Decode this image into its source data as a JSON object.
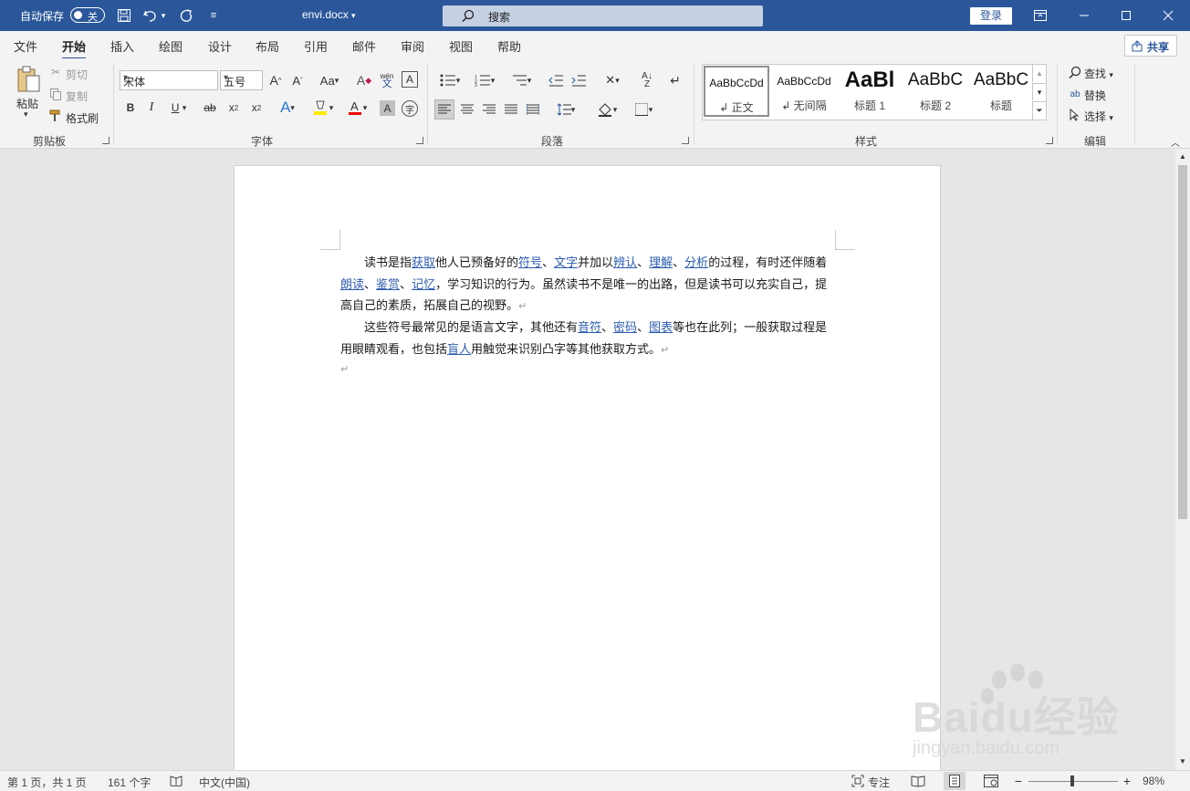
{
  "titlebar": {
    "autosave_label": "自动保存",
    "autosave_state": "关",
    "filename": "envi.docx",
    "search_placeholder": "搜索",
    "login_label": "登录",
    "colors": {
      "bar": "#2b579a"
    }
  },
  "tabs": [
    "文件",
    "开始",
    "插入",
    "绘图",
    "设计",
    "布局",
    "引用",
    "邮件",
    "审阅",
    "视图",
    "帮助"
  ],
  "active_tab": "开始",
  "share_label": "共享",
  "clipboard": {
    "paste": "粘贴",
    "cut": "剪切",
    "copy": "复制",
    "format_painter": "格式刷",
    "group": "剪贴板"
  },
  "font": {
    "name": "宋体",
    "size": "五号",
    "group": "字体",
    "phonetic_top": "wén",
    "phonetic_bottom": "文",
    "aa": "Aa"
  },
  "paragraph": {
    "group": "段落"
  },
  "styles": {
    "items": [
      {
        "preview": "AaBbCcDd",
        "name": "↲ 正文"
      },
      {
        "preview": "AaBbCcDd",
        "name": "↲ 无间隔"
      },
      {
        "preview": "AaBl",
        "name": "标题 1"
      },
      {
        "preview": "AaBbC",
        "name": "标题 2"
      },
      {
        "preview": "AaBbC",
        "name": "标题"
      }
    ],
    "group": "样式"
  },
  "editing": {
    "find": "查找",
    "replace": "替换",
    "select": "选择",
    "group": "编辑"
  },
  "document": {
    "p1": [
      {
        "t": "读书是指",
        "link": false
      },
      {
        "t": "获取",
        "link": true
      },
      {
        "t": "他人已预备好的",
        "link": false
      },
      {
        "t": "符号",
        "link": true
      },
      {
        "t": "、",
        "link": false
      },
      {
        "t": "文字",
        "link": true
      },
      {
        "t": "并加以",
        "link": false
      },
      {
        "t": "辨认",
        "link": true
      },
      {
        "t": "、",
        "link": false
      },
      {
        "t": "理解",
        "link": true
      },
      {
        "t": "、",
        "link": false
      },
      {
        "t": "分析",
        "link": true
      },
      {
        "t": "的过程，有时还伴随着",
        "link": false
      },
      {
        "t": "朗读",
        "link": true
      },
      {
        "t": "、",
        "link": false
      },
      {
        "t": "鉴赏",
        "link": true
      },
      {
        "t": "、",
        "link": false
      },
      {
        "t": "记忆",
        "link": true
      },
      {
        "t": "，学习知识的行为。虽然读书不是唯一的出路，但是读书可以充实自己，提高自己的素质，拓展自己的视野。",
        "link": false
      }
    ],
    "p2": [
      {
        "t": "这些符号最常见的是语言文字，其他还有",
        "link": false
      },
      {
        "t": "音符",
        "link": true
      },
      {
        "t": "、",
        "link": false
      },
      {
        "t": "密码",
        "link": true
      },
      {
        "t": "、",
        "link": false
      },
      {
        "t": "图表",
        "link": true
      },
      {
        "t": "等也在此列；一般获取过程是用眼睛观看，也包括",
        "link": false
      },
      {
        "t": "盲人",
        "link": true
      },
      {
        "t": "用触觉来识别凸字等其他获取方式。",
        "link": false
      }
    ],
    "paragraph_mark": "↵",
    "link_color": "#2c5db0"
  },
  "status": {
    "page": "第 1 页，共 1 页",
    "words": "161 个字",
    "language": "中文(中国)",
    "focus": "专注",
    "zoom": "98%",
    "zoom_value": 0.98
  },
  "watermark": {
    "brand": "Baidu经验",
    "url": "jingyan.baidu.com"
  }
}
